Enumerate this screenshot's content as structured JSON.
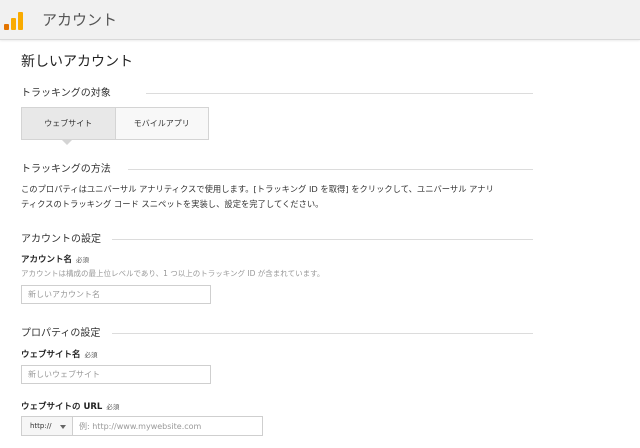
{
  "header": {
    "title": "アカウント",
    "logo_icon": "analytics-logo-icon"
  },
  "page_title": "新しいアカウント",
  "tracking_target": {
    "heading": "トラッキングの対象",
    "options": [
      "ウェブサイト",
      "モバイルアプリ"
    ],
    "selected": "ウェブサイト"
  },
  "tracking_method": {
    "heading": "トラッキングの方法",
    "description_line1": "このプロパティはユニバーサル アナリティクスで使用します。[トラッキング ID を取得] をクリックして、ユニバーサル アナリ",
    "description_line2": "ティクスのトラッキング コード スニペットを実装し、設定を完了してください。"
  },
  "account_settings": {
    "heading": "アカウントの設定",
    "account_name_label": "アカウント名",
    "required": "必須",
    "account_name_hint": "アカウントは構成の最上位レベルであり、1 つ以上のトラッキング ID が含まれています。",
    "account_name_placeholder": "新しいアカウント名"
  },
  "property_settings": {
    "heading": "プロパティの設定",
    "website_name_label": "ウェブサイト名",
    "required": "必須",
    "website_name_placeholder": "新しいウェブサイト",
    "website_url_label": "ウェブサイトの URL",
    "protocol_value": "http://",
    "website_url_placeholder": "例: http://www.mywebsite.com"
  }
}
